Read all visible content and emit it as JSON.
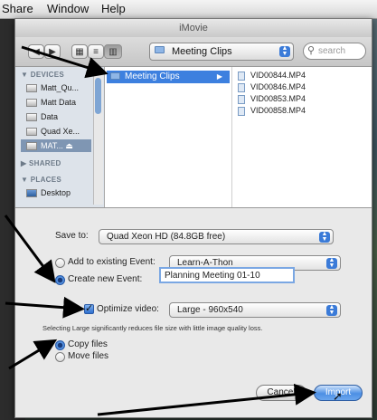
{
  "menubar": {
    "items": [
      "Share",
      "Window",
      "Help"
    ]
  },
  "window": {
    "title": "iMovie"
  },
  "toolbar": {
    "path": "Meeting Clips",
    "search_placeholder": "search"
  },
  "sidebar": {
    "sections": [
      {
        "title": "DEVICES",
        "items": [
          "Matt_Qu...",
          "Matt Data",
          "Data",
          "Quad Xe...",
          "MAT..."
        ]
      },
      {
        "title": "SHARED",
        "items": []
      },
      {
        "title": "PLACES",
        "items": [
          "Desktop"
        ]
      }
    ]
  },
  "browser": {
    "folder": "Meeting Clips",
    "files": [
      "VID00844.MP4",
      "VID00846.MP4",
      "VID00853.MP4",
      "VID00858.MP4"
    ]
  },
  "form": {
    "save_to_label": "Save to:",
    "save_to_value": "Quad Xeon HD (84.8GB free)",
    "add_existing_label": "Add to existing Event:",
    "existing_event_value": "Learn-A-Thon",
    "create_new_label": "Create new Event:",
    "new_event_value": "Planning Meeting 01-10",
    "optimize_label": "Optimize video:",
    "optimize_value": "Large - 960x540",
    "optimize_note": "Selecting Large significantly reduces file size with little image quality loss.",
    "copy_label": "Copy files",
    "move_label": "Move files"
  },
  "buttons": {
    "cancel": "Cancel",
    "import": "Import"
  },
  "colors": {
    "accent": "#3d80df",
    "arrow": "#000000"
  }
}
